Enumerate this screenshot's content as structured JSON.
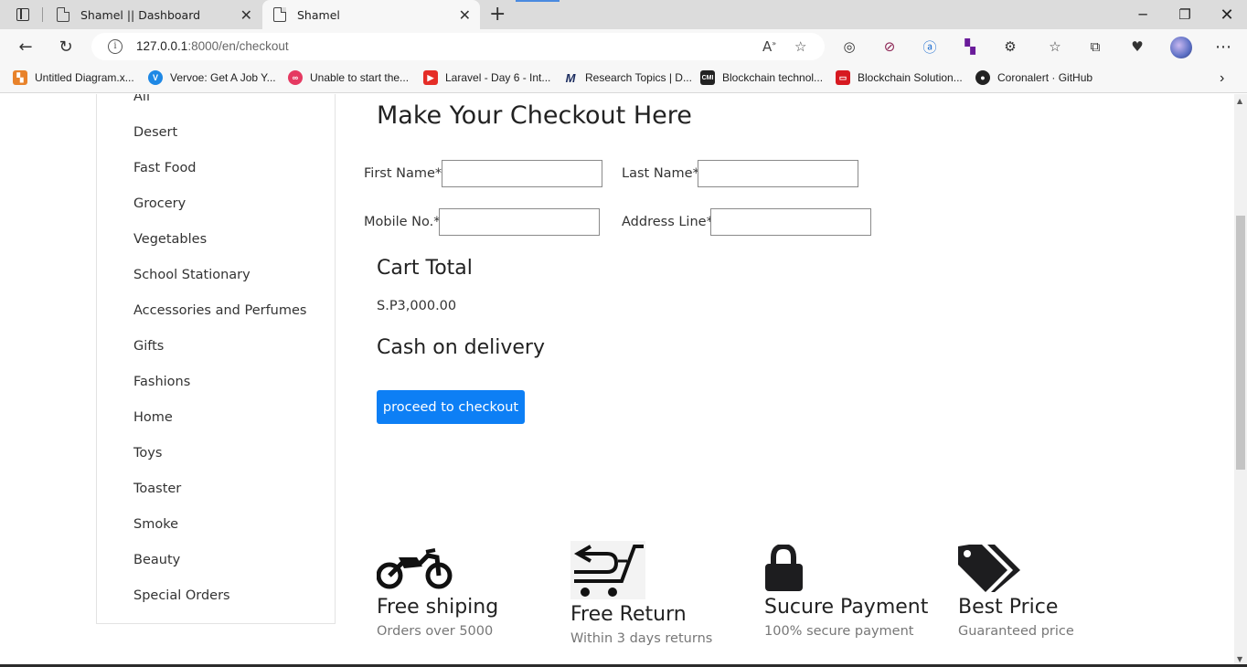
{
  "browser": {
    "tabs": [
      {
        "title": "Shamel || Dashboard"
      },
      {
        "title": "Shamel"
      }
    ],
    "url_host": "127.0.0.1",
    "url_rest": ":8000/en/checkout",
    "bookmarks": [
      {
        "label": "Untitled Diagram.x...",
        "color": "#e8822a"
      },
      {
        "label": "Vervoe: Get A Job Y...",
        "color": "#1e88e5"
      },
      {
        "label": "Unable to start the...",
        "color": "#e53961"
      },
      {
        "label": "Laravel - Day 6 - Int...",
        "color": "#e52d27"
      },
      {
        "label": "Research Topics | D...",
        "color": "#1a2b5e"
      },
      {
        "label": "Blockchain technol...",
        "color": "#222222"
      },
      {
        "label": "Blockchain Solution...",
        "color": "#d71920"
      },
      {
        "label": "Coronalert · GitHub",
        "color": "#222222"
      }
    ]
  },
  "sidebar": {
    "categories": [
      "All",
      "Desert",
      "Fast Food",
      "Grocery",
      "Vegetables",
      "School Stationary",
      "Accessories and Perfumes",
      "Gifts",
      "Fashions",
      "Home",
      "Toys",
      "Toaster",
      "Smoke",
      "Beauty",
      "Special Orders"
    ]
  },
  "checkout": {
    "title": "Make Your Checkout Here",
    "first_name_label": "First Name*",
    "last_name_label": "Last Name*",
    "mobile_label": "Mobile No.*",
    "address_label": "Address Line*",
    "cart_total_heading": "Cart Total",
    "cart_total_value": "S.P3,000.00",
    "payment_method": "Cash on delivery",
    "proceed_button": "proceed to checkout"
  },
  "features": [
    {
      "title": "Free shiping",
      "subtitle": "Orders over 5000",
      "icon": "motorcycle-icon"
    },
    {
      "title": "Free Return",
      "subtitle": "Within 3 days returns",
      "icon": "cart-return-icon"
    },
    {
      "title": "Sucure Payment",
      "subtitle": "100% secure payment",
      "icon": "lock-icon"
    },
    {
      "title": "Best Price",
      "subtitle": "Guaranteed price",
      "icon": "tags-icon"
    }
  ],
  "colors": {
    "accent": "#0d7ff5"
  }
}
